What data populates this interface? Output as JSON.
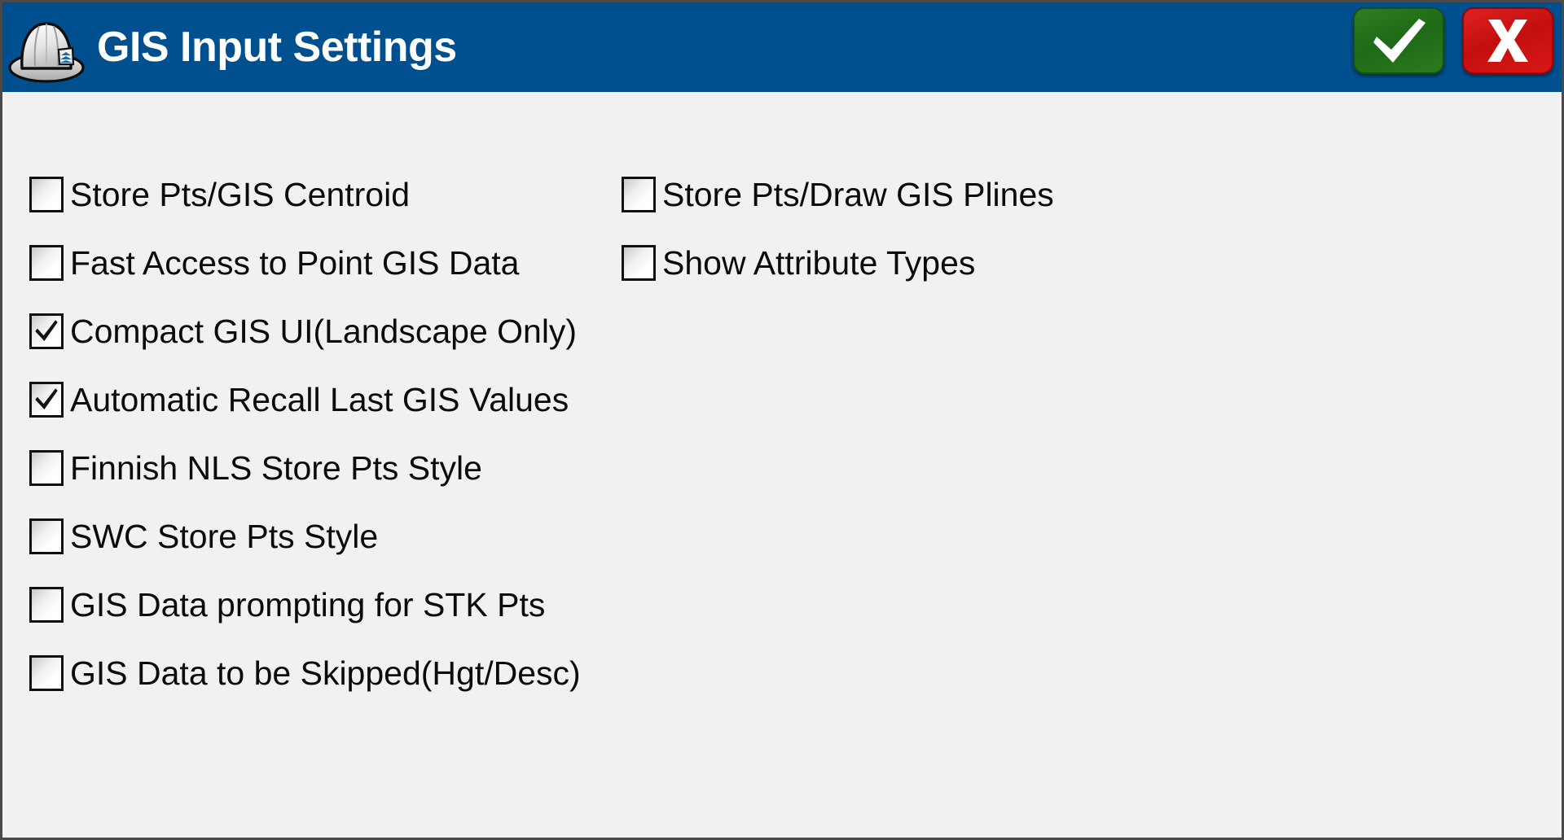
{
  "window": {
    "title": "GIS Input Settings",
    "icon": "hard-hat-icon",
    "titlebar_color": "#00508f",
    "body_color": "#f1f1f1"
  },
  "titlebar": {
    "ok_button": {
      "icon": "checkmark-icon",
      "label": "",
      "color": "#2a7a20"
    },
    "cancel_button": {
      "icon": "x-icon",
      "label": "",
      "color": "#d81717"
    }
  },
  "options": {
    "left_column": [
      {
        "label": "Store Pts/GIS Centroid",
        "checked": false
      },
      {
        "label": "Fast Access to Point GIS Data",
        "checked": false
      },
      {
        "label": "Compact GIS UI(Landscape Only)",
        "checked": true
      },
      {
        "label": "Automatic Recall Last GIS Values",
        "checked": true
      },
      {
        "label": "Finnish NLS Store Pts Style",
        "checked": false
      },
      {
        "label": "SWC Store Pts Style",
        "checked": false
      },
      {
        "label": "GIS Data prompting for STK Pts",
        "checked": false
      },
      {
        "label": "GIS Data to be Skipped(Hgt/Desc)",
        "checked": false
      }
    ],
    "right_column": [
      {
        "label": "Store Pts/Draw GIS Plines",
        "checked": false
      },
      {
        "label": "Show Attribute Types",
        "checked": false
      }
    ]
  }
}
